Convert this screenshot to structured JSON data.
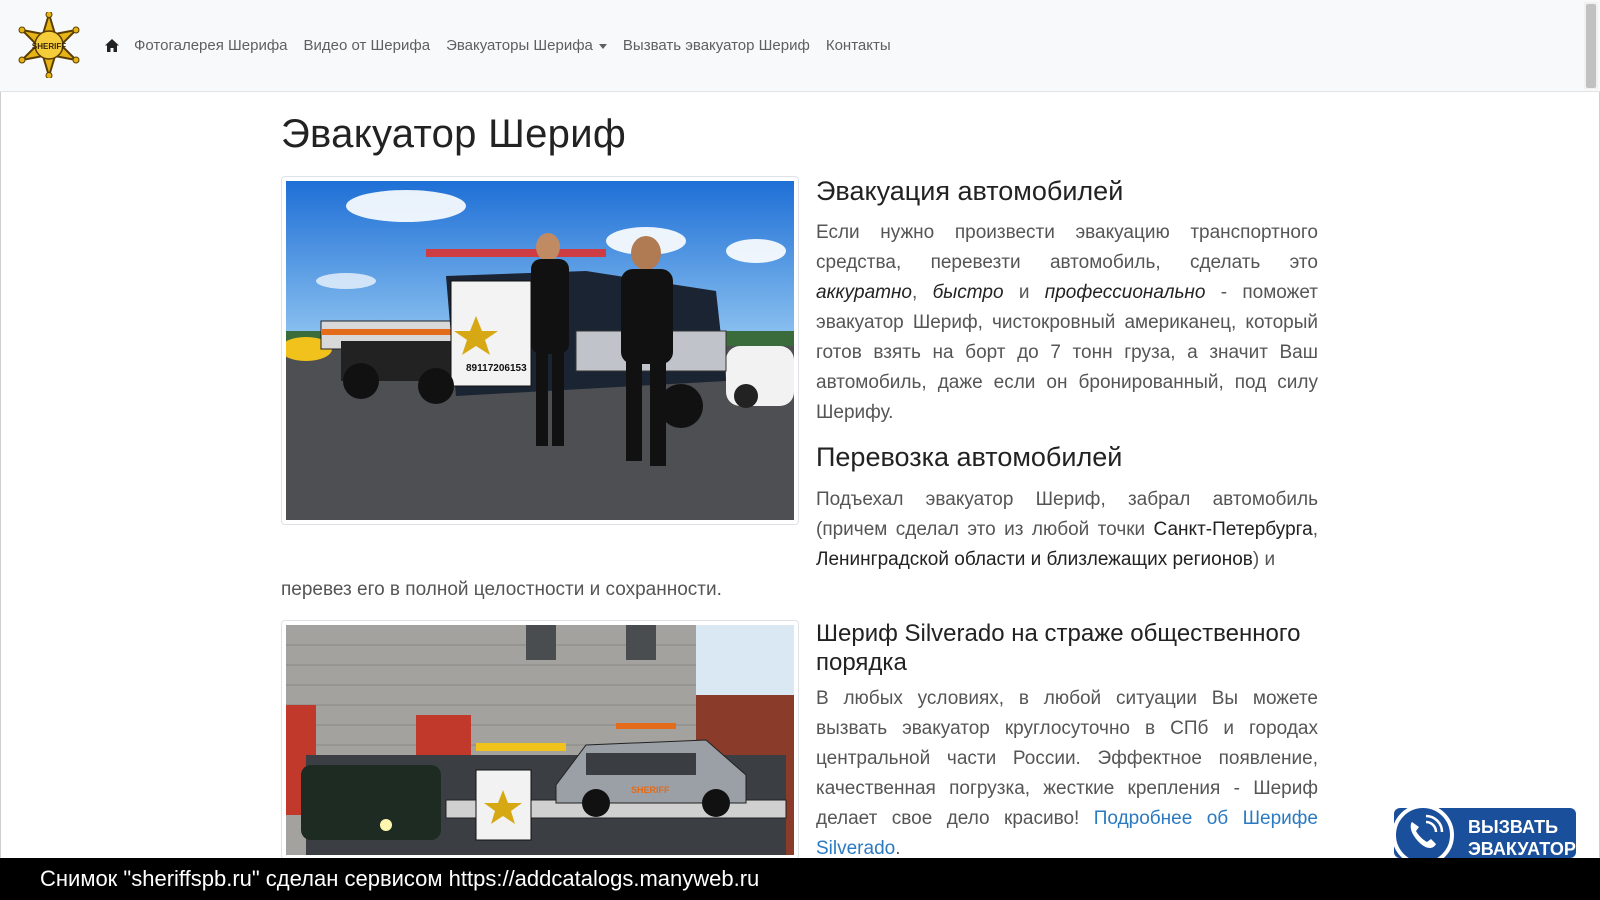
{
  "nav": {
    "home_icon": "home-icon",
    "items": [
      {
        "label": "Фотогалерея Шерифа"
      },
      {
        "label": "Видео от Шерифа"
      },
      {
        "label": "Эвакуаторы Шерифа",
        "dropdown": true
      },
      {
        "label": "Вызвать эвакуатор Шериф"
      },
      {
        "label": "Контакты"
      }
    ],
    "logo_text": "SHERIFF"
  },
  "page": {
    "title": "Эвакуатор Шериф"
  },
  "section1": {
    "heading": "Эвакуация автомобилей",
    "text_a": "Если нужно произвести эвакуацию транспортного средства, перевезти автомобиль, сделать это ",
    "em1": "аккуратно",
    "sep1": ", ",
    "em2": "быстро",
    "sep2": " и ",
    "em3": "профессионально",
    "text_b": " - поможет эвакуатор Шериф, чистокровный американец, который готов взять на борт до 7 тонн груза, а значит Ваш автомобиль, даже если он бронированный, под силу Шерифу."
  },
  "section2": {
    "heading": "Перевозка автомобилей",
    "text_a": "Подъехал эвакуатор Шериф, забрал автомобиль (причем сделал это из любой точки ",
    "strong1": "Санкт-Петербурга",
    "sep1": ", ",
    "strong2": "Ленинградской области и близлежащих регионов",
    "text_b": ") и",
    "text_tail": "перевез его в полной целостности и сохранности."
  },
  "section3": {
    "heading": "Шериф Silverado на страже общественного порядка",
    "text_a": "В любых условиях, в любой ситуации Вы можете вызвать эвакуатор круглосуточно в СПб и городах центральной части России. Эффектное появление, качественная погрузка, жесткие крепления - Шериф делает свое дело красиво! ",
    "link": "Подробнее об Шерифе Silverado",
    "text_b": "."
  },
  "images": {
    "photo1_truck_plate": "89117206153",
    "photo2_car_text": "SHERIFF"
  },
  "call_button": {
    "line1": "ВЫЗВАТЬ",
    "line2": "ЭВАКУАТОР",
    "icon": "phone-icon"
  },
  "banner": {
    "text": "Снимок \"sheriffspb.ru\" сделан сервисом https://addcatalogs.manyweb.ru"
  },
  "colors": {
    "link": "#2b7ac1",
    "navbar_bg": "#f8f9fa",
    "call_button": "#1a4f9c",
    "badge_gold": "#e7b416"
  }
}
